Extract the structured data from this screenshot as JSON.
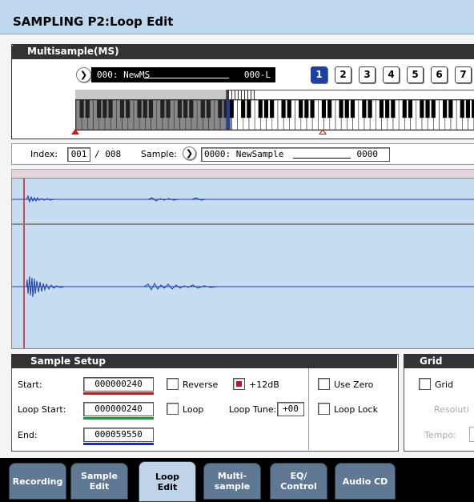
{
  "title": "SAMPLING P2:Loop Edit",
  "multisample": {
    "header": "Multisample(MS)",
    "arrow": "❯",
    "name_left": "000: NewMS",
    "name_right": "000-L",
    "buttons": [
      "1",
      "2",
      "3",
      "4",
      "5",
      "6",
      "7"
    ],
    "active_button": "1"
  },
  "index_row": {
    "index_label": "Index:",
    "index_value": "001",
    "index_total": "/ 008",
    "sample_label": "Sample:",
    "sample_name": "0000: NewSample",
    "sample_suffix": "0000"
  },
  "sample_setup": {
    "header": "Sample Setup",
    "start_label": "Start:",
    "start_value": "000000240",
    "loop_start_label": "Loop Start:",
    "loop_start_value": "000000240",
    "end_label": "End:",
    "end_value": "000059550",
    "reverse_label": "Reverse",
    "reverse_checked": false,
    "plus12_label": "+12dB",
    "plus12_checked": true,
    "loop_label": "Loop",
    "loop_checked": false,
    "loop_tune_label": "Loop Tune:",
    "loop_tune_value": "+00",
    "use_zero_label": "Use Zero",
    "use_zero_checked": false,
    "loop_lock_label": "Loop Lock",
    "loop_lock_checked": false,
    "colors": {
      "start": "#c41a1a",
      "loop_start": "#1a9c2a",
      "end": "#1a2ec4"
    }
  },
  "grid": {
    "header": "Grid",
    "grid_label": "Grid",
    "grid_checked": false,
    "resolution_label": "Resoluti",
    "tempo_label": "Tempo:"
  },
  "tabs": [
    {
      "line1": "Recording",
      "line2": ""
    },
    {
      "line1": "Sample",
      "line2": "Edit"
    },
    {
      "line1": "Loop",
      "line2": "Edit"
    },
    {
      "line1": "Multi-",
      "line2": "sample"
    },
    {
      "line1": "EQ/",
      "line2": "Control"
    },
    {
      "line1": "Audio CD",
      "line2": ""
    }
  ],
  "active_tab": 2
}
